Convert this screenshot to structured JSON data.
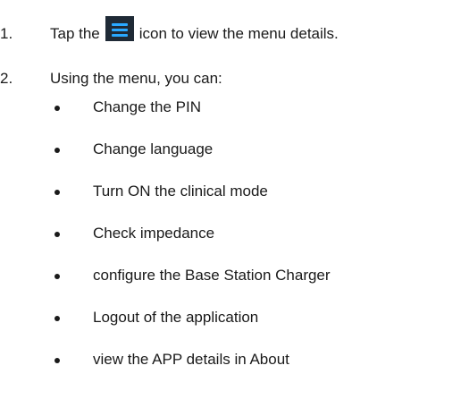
{
  "steps": [
    {
      "number": "1.",
      "text_before": "Tap the",
      "icon": "hamburger-menu-icon",
      "text_after": "icon to view the menu details."
    },
    {
      "number": "2.",
      "text": "Using the menu, you can:"
    }
  ],
  "menu_options": [
    "Change the PIN",
    "Change language",
    "Turn ON the clinical mode",
    "Check impedance",
    "configure the Base Station Charger",
    "Logout of the application",
    "view the APP details in About"
  ],
  "colors": {
    "icon_background": "#1f2a36",
    "icon_bars": "#2aa8ff",
    "text": "#1a1a1a"
  }
}
